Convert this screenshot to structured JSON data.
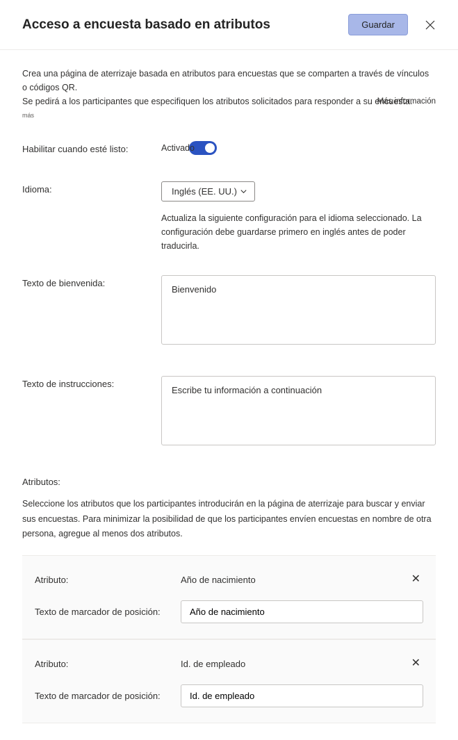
{
  "header": {
    "title": "Acceso a encuesta basado en atributos",
    "save_label": "Guardar"
  },
  "description": {
    "line1": "Crea una página de aterrizaje basada en atributos para encuestas que se comparten a través de vínculos o códigos QR.",
    "line2": "Se pedirá a los participantes que especifiquen los atributos solicitados para responder a su encuesta.",
    "learn_more": "Más información",
    "line3": "más"
  },
  "enable": {
    "label": "Habilitar cuando esté listo:",
    "state_label": "Activado"
  },
  "language": {
    "label": "Idioma:",
    "selected": "Inglés (EE. UU.)",
    "helper": "Actualiza la siguiente configuración para el idioma seleccionado. La configuración debe guardarse primero en inglés antes de poder traducirla."
  },
  "welcome": {
    "label": "Texto de bienvenida:",
    "value": "Bienvenido"
  },
  "instructions": {
    "label": "Texto de instrucciones:",
    "value": "Escribe tu información a continuación"
  },
  "attributes": {
    "heading": "Atributos:",
    "description": "Seleccione los atributos que los participantes introducirán en la página de aterrizaje para buscar y enviar sus encuestas. Para minimizar la posibilidad de que los participantes envíen encuestas en nombre de otra persona, agregue al menos dos atributos.",
    "attribute_label": "Atributo:",
    "placeholder_label": "Texto de marcador de posición:",
    "items": [
      {
        "name": "Año de nacimiento",
        "placeholder": "Año de nacimiento"
      },
      {
        "name": "Id. de empleado",
        "placeholder": "Id. de empleado"
      }
    ]
  }
}
